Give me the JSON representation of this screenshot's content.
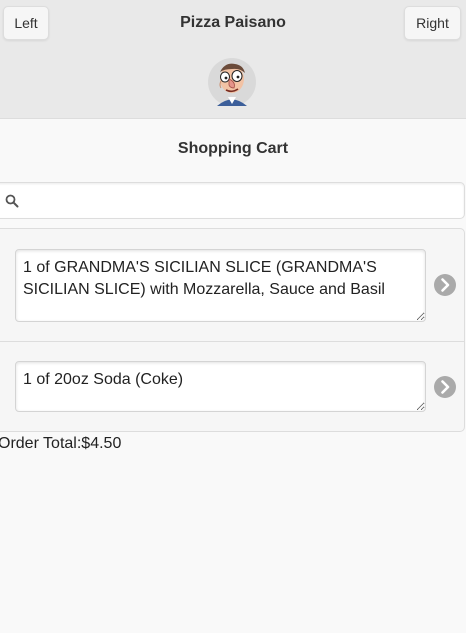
{
  "header": {
    "left_label": "Left",
    "title": "Pizza Paisano",
    "right_label": "Right"
  },
  "cart": {
    "title": "Shopping Cart",
    "search_placeholder": "",
    "items": [
      {
        "text": "1 of GRANDMA'S SICILIAN SLICE (GRANDMA'S SICILIAN SLICE) with Mozzarella, Sauce and Basil"
      },
      {
        "text": "1 of 20oz Soda (Coke)"
      }
    ],
    "total_label": "Order Total:",
    "total_value": "$4.50"
  },
  "icons": {
    "search": "search-icon",
    "chevron": "chevron-right-icon",
    "logo": "chef-caricature-logo"
  },
  "colors": {
    "header_bg": "#e9e9e9",
    "page_bg": "#f9f9f9",
    "chevron": "#aaaaaa"
  }
}
